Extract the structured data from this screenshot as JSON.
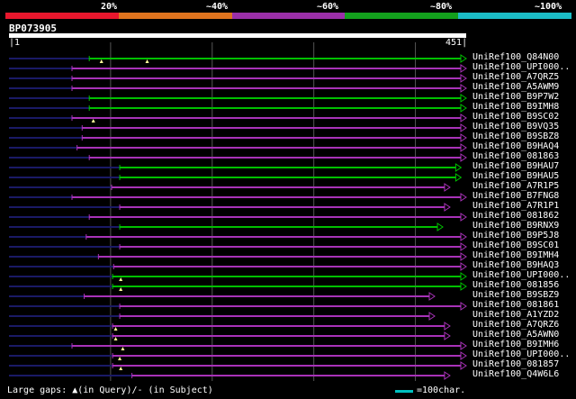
{
  "legend": {
    "labels": [
      "20%",
      "~40%",
      "~60%",
      "~80%",
      "~100%"
    ],
    "colors": [
      "#e8172d",
      "#e0741e",
      "#9b2fa8",
      "#13a01d",
      "#1bbcc6"
    ]
  },
  "query": {
    "id": "BP073905",
    "start": "1",
    "end": "451",
    "length": 451
  },
  "footer": {
    "gaps_text": "Large gaps: ▲(in Query)/- (in Subject)",
    "scale_text": "=100char."
  },
  "colors": {
    "green": "#00c000",
    "purple": "#a832b8",
    "navy": "#1a1a66",
    "gap": "#ffff99"
  },
  "hits": [
    {
      "name": "UniRef100_Q84N00",
      "start": 80,
      "end": 451,
      "color": "green",
      "arrow": true,
      "gaps": [
        92,
        137
      ]
    },
    {
      "name": "UniRef100_UPI000..",
      "start": 63,
      "end": 451,
      "color": "purple",
      "arrow": true,
      "gaps": []
    },
    {
      "name": "UniRef100_A7QRZ5",
      "start": 63,
      "end": 451,
      "color": "purple",
      "arrow": true,
      "gaps": []
    },
    {
      "name": "UniRef100_A5AWM9",
      "start": 63,
      "end": 451,
      "color": "purple",
      "arrow": true,
      "gaps": []
    },
    {
      "name": "UniRef100_B9P7W2",
      "start": 80,
      "end": 451,
      "color": "green",
      "arrow": true,
      "gaps": []
    },
    {
      "name": "UniRef100_B9IMH8",
      "start": 80,
      "end": 451,
      "color": "green",
      "arrow": true,
      "gaps": []
    },
    {
      "name": "UniRef100_B9SC02",
      "start": 63,
      "end": 451,
      "color": "purple",
      "arrow": true,
      "gaps": [
        84
      ]
    },
    {
      "name": "UniRef100_B9VQ35",
      "start": 73,
      "end": 451,
      "color": "purple",
      "arrow": true,
      "gaps": []
    },
    {
      "name": "UniRef100_B9SBZ8",
      "start": 73,
      "end": 451,
      "color": "purple",
      "arrow": true,
      "gaps": []
    },
    {
      "name": "UniRef100_B9HAQ4",
      "start": 68,
      "end": 451,
      "color": "purple",
      "arrow": true,
      "gaps": []
    },
    {
      "name": "UniRef100_081863",
      "start": 80,
      "end": 451,
      "color": "purple",
      "arrow": true,
      "gaps": []
    },
    {
      "name": "UniRef100_B9HAU7",
      "start": 110,
      "end": 446,
      "color": "green",
      "arrow": true,
      "gaps": []
    },
    {
      "name": "UniRef100_B9HAU5",
      "start": 110,
      "end": 446,
      "color": "green",
      "arrow": true,
      "gaps": []
    },
    {
      "name": "UniRef100_A7R1P5",
      "start": 102,
      "end": 435,
      "color": "purple",
      "arrow": true,
      "gaps": []
    },
    {
      "name": "UniRef100_B7FNG8",
      "start": 63,
      "end": 451,
      "color": "purple",
      "arrow": true,
      "gaps": []
    },
    {
      "name": "UniRef100_A7R1P1",
      "start": 110,
      "end": 435,
      "color": "purple",
      "arrow": true,
      "gaps": []
    },
    {
      "name": "UniRef100_081862",
      "start": 80,
      "end": 451,
      "color": "purple",
      "arrow": true,
      "gaps": []
    },
    {
      "name": "UniRef100_B9RNX9",
      "start": 110,
      "end": 428,
      "color": "green",
      "arrow": true,
      "gaps": []
    },
    {
      "name": "UniRef100_B9P5J8",
      "start": 77,
      "end": 451,
      "color": "purple",
      "arrow": true,
      "gaps": []
    },
    {
      "name": "UniRef100_B9SC01",
      "start": 110,
      "end": 451,
      "color": "purple",
      "arrow": true,
      "gaps": []
    },
    {
      "name": "UniRef100_B9IMH4",
      "start": 89,
      "end": 451,
      "color": "purple",
      "arrow": true,
      "gaps": []
    },
    {
      "name": "UniRef100_B9HAQ3",
      "start": 104,
      "end": 451,
      "color": "purple",
      "arrow": true,
      "gaps": []
    },
    {
      "name": "UniRef100_UPI000..",
      "start": 103,
      "end": 451,
      "color": "green",
      "arrow": true,
      "gaps": [
        111
      ]
    },
    {
      "name": "UniRef100_081856",
      "start": 103,
      "end": 451,
      "color": "green",
      "arrow": true,
      "gaps": [
        111
      ]
    },
    {
      "name": "UniRef100_B9SBZ9",
      "start": 75,
      "end": 420,
      "color": "purple",
      "arrow": true,
      "gaps": []
    },
    {
      "name": "UniRef100_081861",
      "start": 110,
      "end": 451,
      "color": "purple",
      "arrow": true,
      "gaps": []
    },
    {
      "name": "UniRef100_A1YZD2",
      "start": 110,
      "end": 420,
      "color": "purple",
      "arrow": true,
      "gaps": []
    },
    {
      "name": "UniRef100_A7QRZ6",
      "start": 103,
      "end": 435,
      "color": "purple",
      "arrow": true,
      "gaps": [
        106
      ]
    },
    {
      "name": "UniRef100_A5AWN0",
      "start": 103,
      "end": 435,
      "color": "purple",
      "arrow": true,
      "gaps": [
        106
      ]
    },
    {
      "name": "UniRef100_B9IMH6",
      "start": 63,
      "end": 451,
      "color": "purple",
      "arrow": true,
      "gaps": [
        113
      ]
    },
    {
      "name": "UniRef100_UPI000..",
      "start": 103,
      "end": 451,
      "color": "purple",
      "arrow": true,
      "gaps": [
        110
      ]
    },
    {
      "name": "UniRef100_081857",
      "start": 103,
      "end": 451,
      "color": "purple",
      "arrow": true,
      "gaps": [
        111
      ]
    },
    {
      "name": "UniRef100_Q4W6L6",
      "start": 122,
      "end": 435,
      "color": "purple",
      "arrow": true,
      "gaps": []
    }
  ]
}
